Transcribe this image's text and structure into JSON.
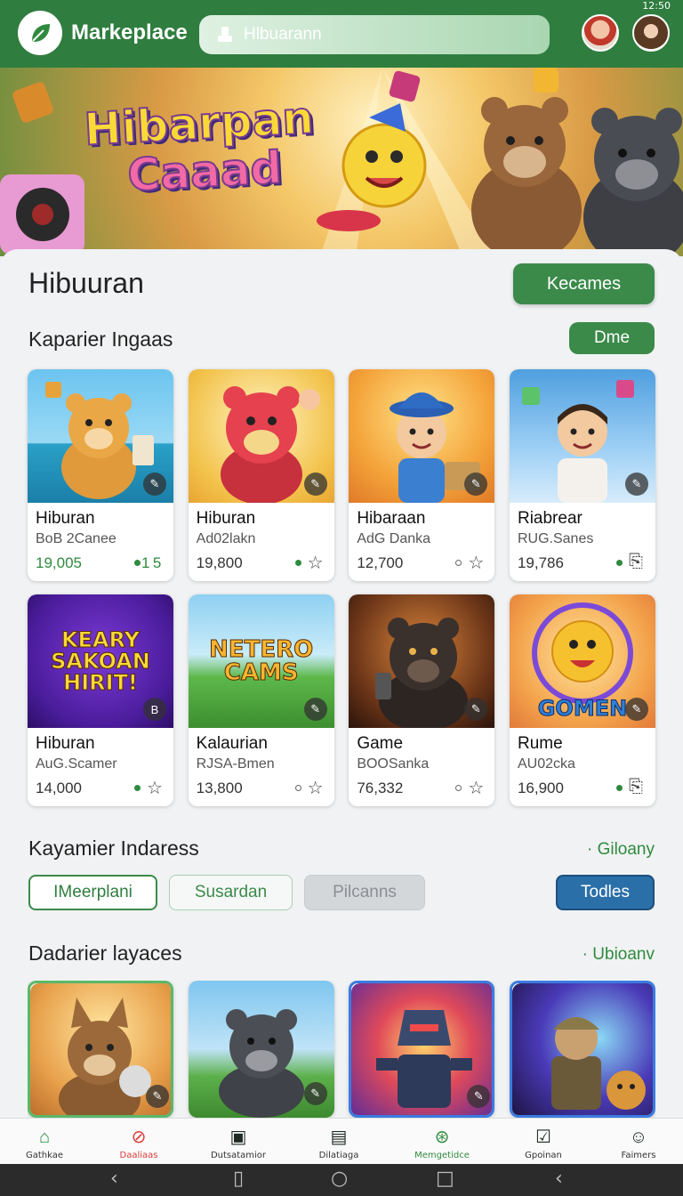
{
  "status": {
    "time": "12:50"
  },
  "header": {
    "title": "Markeplace",
    "search_placeholder": "Hlbuarann"
  },
  "hero": {
    "line1": "Hibarpan",
    "line2": "Caaad"
  },
  "main": {
    "title": "Hibuuran",
    "primary_button": "Kecames",
    "section1": {
      "title": "Kaparier Ingaas",
      "button": "Dme"
    },
    "cards_row1": [
      {
        "name": "Hiburan",
        "sub": "BoB 2Canee",
        "num": "19,005",
        "extra": "1 5"
      },
      {
        "name": "Hiburan",
        "sub": "Ad02lakn",
        "num": "19,800"
      },
      {
        "name": "Hibaraan",
        "sub": "AdG Danka",
        "num": "12,700"
      },
      {
        "name": "Riabrear",
        "sub": "RUG.Sanes",
        "num": "19,786"
      }
    ],
    "cards_row2": [
      {
        "name": "Hiburan",
        "sub": "AuG.Scamer",
        "num": "14,000",
        "art": "KEARY SAKOAN HIRIT!"
      },
      {
        "name": "Kalaurian",
        "sub": "RJSA-Bmen",
        "num": "13,800",
        "art": "NETERO CAMS"
      },
      {
        "name": "Game",
        "sub": "BOOSanka",
        "num": "76,332"
      },
      {
        "name": "Rume",
        "sub": "AU02cka",
        "num": "16,900",
        "art": "GOMEN"
      }
    ],
    "section2": {
      "title": "Kayamier Indaress",
      "link": "Giloany"
    },
    "chips": [
      "IMeerplani",
      "Susardan",
      "Pilcanns",
      "Todles"
    ],
    "section3": {
      "title": "Dadarier layaces",
      "link": "Ubioanv"
    }
  },
  "bottom_nav": [
    "Gathkae",
    "Daaliaas",
    "Dutsatamior",
    "Dilatiaga",
    "Memgetidce",
    "Gpoinan",
    "Faimers"
  ],
  "colors": {
    "brand": "#2f7d3f",
    "accent": "#3b8a4a",
    "chip_active": "#2b6fa8"
  }
}
